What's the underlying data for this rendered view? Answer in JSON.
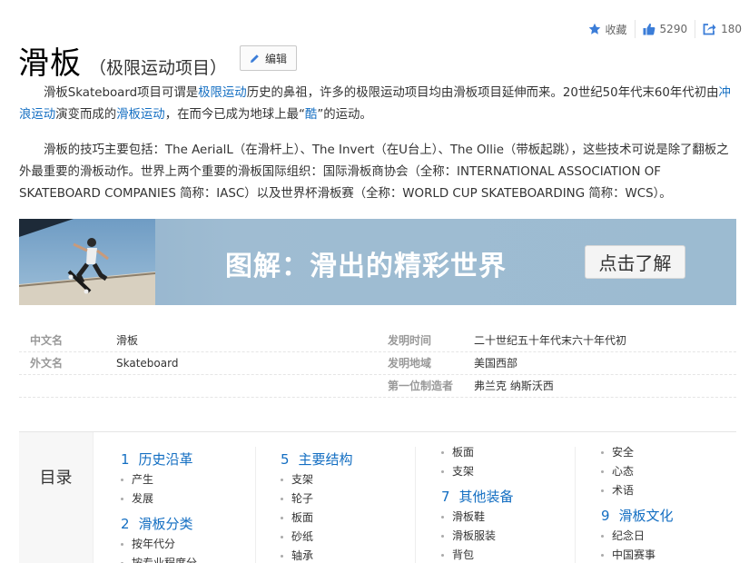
{
  "actions": {
    "collect_label": "收藏",
    "like_count": "5290",
    "share_count": "180"
  },
  "header": {
    "title": "滑板",
    "subtitle": "（极限运动项目）",
    "edit_label": "编辑"
  },
  "paragraph1": {
    "t1": "滑板Skateboard项目可谓是",
    "link1": "极限运动",
    "t2": "历史的鼻祖，许多的极限运动项目均由滑板项目延伸而来。20世纪50年代末60年代初由",
    "link2": "冲浪运动",
    "t3": "演变而成的",
    "link3": "滑板运动",
    "t4": "，在而今已成为地球上最“",
    "link4": "酷",
    "t5": "”的运动。"
  },
  "paragraph2": {
    "text": "滑板的技巧主要包括：The AerialL（在滑杆上）、The Invert（在U台上）、The Ollie（带板起跳），这些技术可说是除了翻板之外最重要的滑板动作。世界上两个重要的滑板国际组织：国际滑板商协会（全称：INTERNATIONAL ASSOCIATION OF SKATEBOARD COMPANIES 简称：IASC）以及世界杯滑板赛（全称：WORLD CUP SKATEBOARDING 简称：WCS）。"
  },
  "banner": {
    "text": "图解：滑出的精彩世界",
    "button": "点击了解"
  },
  "info": [
    {
      "k1": "中文名",
      "v1": "滑板",
      "k2": "发明时间",
      "v2": "二十世纪五十年代末六十年代初"
    },
    {
      "k1": "外文名",
      "v1": "Skateboard",
      "k2": "发明地域",
      "v2": "美国西部"
    },
    {
      "k1": "",
      "v1": "",
      "k2": "第一位制造者",
      "v2": "弗兰克 纳斯沃西"
    }
  ],
  "catalog": {
    "label": "目录",
    "col1": {
      "s1_num": "1",
      "s1_title": "历史沿革",
      "s1_items": [
        "产生",
        "发展"
      ],
      "s2_num": "2",
      "s2_title": "滑板分类",
      "s2_items": [
        "按年代分",
        "按专业程度分"
      ]
    },
    "col2": {
      "s5_num": "5",
      "s5_title": "主要结构",
      "s5_items": [
        "支架",
        "轮子",
        "板面",
        "砂纸",
        "轴承"
      ]
    },
    "col3": {
      "pre_items": [
        "板面",
        "支架"
      ],
      "s7_num": "7",
      "s7_title": "其他装备",
      "s7_items": [
        "滑板鞋",
        "滑板服装",
        "背包"
      ]
    },
    "col4": {
      "pre_items": [
        "安全",
        "心态",
        "术语"
      ],
      "s9_num": "9",
      "s9_title": "滑板文化",
      "s9_items": [
        "纪念日",
        "中国赛事"
      ]
    }
  }
}
